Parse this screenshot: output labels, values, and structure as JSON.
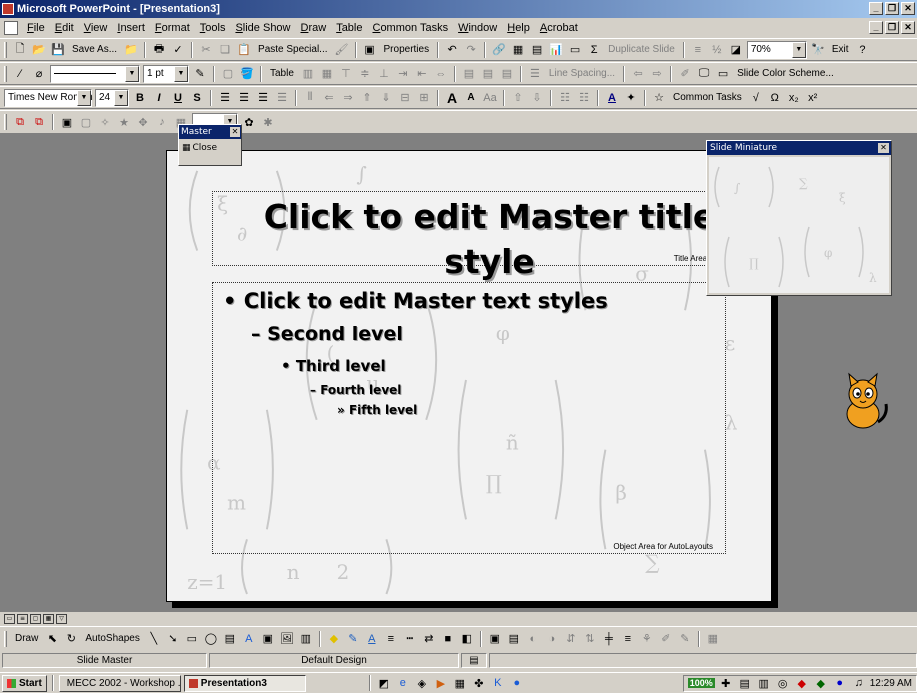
{
  "window": {
    "title": "Microsoft PowerPoint - [Presentation3]"
  },
  "menu": [
    "File",
    "Edit",
    "View",
    "Insert",
    "Format",
    "Tools",
    "Slide Show",
    "Draw",
    "Table",
    "Common Tasks",
    "Window",
    "Help",
    "Acrobat"
  ],
  "toolbar1": {
    "save_as": "Save As...",
    "paste_special": "Paste Special...",
    "properties": "Properties",
    "duplicate_slide": "Duplicate Slide",
    "zoom": "70%",
    "exit": "Exit"
  },
  "toolbar2": {
    "line_weight": "1 pt",
    "table": "Table",
    "line_spacing": "Line Spacing...",
    "slide_color_scheme": "Slide Color Scheme..."
  },
  "toolbar3": {
    "font": "Times New Roman",
    "size": "24",
    "bold": "B",
    "italic": "I",
    "underline": "U",
    "shadow": "S",
    "grow_font": "A",
    "shrink_font": "A",
    "common_tasks": "Common Tasks"
  },
  "master_toolbar": {
    "title": "Master",
    "close": "Close"
  },
  "slide": {
    "title": "Click to edit Master title style",
    "title_area_label": "Title Area for AutoLayouts",
    "levels": [
      "Click to edit Master text styles",
      "Second level",
      "Third level",
      "Fourth level",
      "Fifth level"
    ],
    "bullets": [
      "•",
      "–",
      "•",
      "–",
      "»"
    ],
    "object_area_label": "Object Area for AutoLayouts"
  },
  "miniature": {
    "title": "Slide Miniature"
  },
  "drawbar": {
    "draw": "Draw",
    "autoshapes": "AutoShapes"
  },
  "statusbar": {
    "view": "Slide Master",
    "design": "Default Design"
  },
  "taskbar": {
    "start": "Start",
    "tasks": [
      "MECC 2002 - Workshop ...",
      "Presentation3"
    ],
    "zoom": "100%",
    "clock": "12:29 AM"
  },
  "colors": {
    "titlebar": "#0a246a",
    "face": "#d4d0c8",
    "workspace": "#808080"
  }
}
